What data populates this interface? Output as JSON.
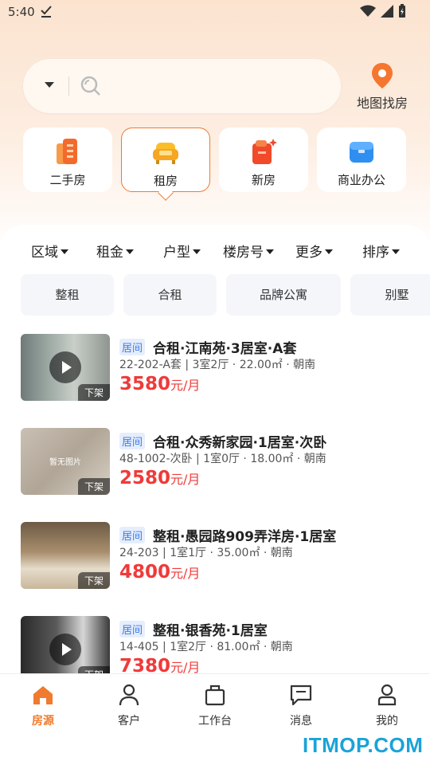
{
  "status_bar": {
    "time": "5:40"
  },
  "search": {
    "placeholder": ""
  },
  "map_search": {
    "label": "地图找房"
  },
  "categories": [
    {
      "label": "二手房",
      "active": false
    },
    {
      "label": "租房",
      "active": true
    },
    {
      "label": "新房",
      "active": false
    },
    {
      "label": "商业办公",
      "active": false
    }
  ],
  "filters": [
    "区域",
    "租金",
    "户型",
    "楼房号",
    "更多",
    "排序"
  ],
  "quick_tags": [
    "整租",
    "合租",
    "品牌公寓",
    "别墅"
  ],
  "listings": [
    {
      "badge": "居间",
      "title": "合租·江南苑·3居室·A套",
      "meta": "22-202-A套 | 3室2厅 · 22.00㎡ · 朝南",
      "price": "3580",
      "unit": "元/月",
      "thumb_badge": "下架",
      "video": true
    },
    {
      "badge": "居间",
      "title": "合租·众秀新家园·1居室·次卧",
      "meta": "48-1002-次卧 | 1室0厅 · 18.00㎡ · 朝南",
      "price": "2580",
      "unit": "元/月",
      "thumb_badge": "下架",
      "thumb_text": "暂无图片",
      "video": false
    },
    {
      "badge": "居间",
      "title": "整租·愚园路909弄洋房·1居室",
      "meta": "24-203 | 1室1厅 · 35.00㎡ · 朝南",
      "price": "4800",
      "unit": "元/月",
      "thumb_badge": "下架",
      "video": false
    },
    {
      "badge": "居间",
      "title": "整租·银香苑·1居室",
      "meta": "14-405 | 1室2厅 · 81.00㎡ · 朝南",
      "price": "7380",
      "unit": "元/月",
      "thumb_badge": "下架",
      "video": true
    }
  ],
  "tabs": [
    {
      "label": "房源",
      "icon": "home-icon",
      "active": true
    },
    {
      "label": "客户",
      "icon": "person-icon",
      "active": false
    },
    {
      "label": "工作台",
      "icon": "briefcase-icon",
      "active": false
    },
    {
      "label": "消息",
      "icon": "message-icon",
      "active": false
    },
    {
      "label": "我的",
      "icon": "profile-icon",
      "active": false
    }
  ],
  "colors": {
    "accent": "#f07a2e",
    "price": "#f03a3a",
    "badge": "#3a7be8"
  },
  "watermark": "ITMOP.COM"
}
